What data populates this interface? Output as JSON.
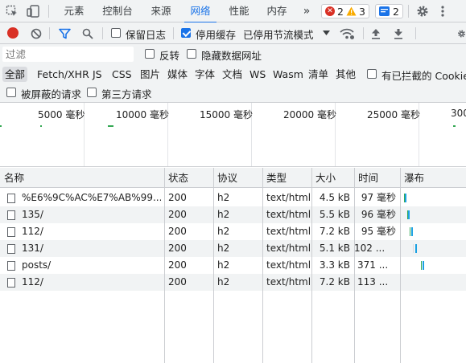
{
  "tabs": [
    "元素",
    "控制台",
    "来源",
    "网络",
    "性能",
    "内存"
  ],
  "active_tab": "网络",
  "more_tabs": "»",
  "badges": {
    "errors": "2",
    "warnings": "3",
    "messages": "2"
  },
  "icons": {
    "inspect": "inspect-element-icon",
    "device": "device-toolbar-icon",
    "record": "record-icon",
    "clear": "clear-icon",
    "filter": "filter-icon",
    "search": "search-icon",
    "wifi": "network-conditions-icon",
    "upload": "import-har-icon",
    "download": "export-har-icon",
    "gear": "gear-icon",
    "kebab": "more-options-icon"
  },
  "toolbar": {
    "preserve_log": "保留日志",
    "disable_cache": "停用缓存",
    "throttle": "已停用节流模式"
  },
  "filter": {
    "placeholder": "过滤",
    "invert": "反转",
    "hide_data_urls": "隐藏数据网址"
  },
  "types": [
    "全部",
    "Fetch/XHR",
    "JS",
    "CSS",
    "图片",
    "媒体",
    "字体",
    "文档",
    "WS",
    "Wasm",
    "清单",
    "其他"
  ],
  "selected_type": "全部",
  "blocked_cookies": "有已拦截的 Cookie",
  "blocked_requests": "被屏蔽的请求",
  "third_party": "第三方请求",
  "timeline": [
    "5000 毫秒",
    "10000 毫秒",
    "15000 毫秒",
    "20000 毫秒",
    "25000 毫秒",
    "300"
  ],
  "columns": [
    "名称",
    "状态",
    "协议",
    "类型",
    "大小",
    "时间",
    "瀑布"
  ],
  "requests": [
    {
      "name": "%E6%9C%AC%E7%AB%99...",
      "status": "200",
      "protocol": "h2",
      "type": "text/html",
      "size": "4.5 kB",
      "time": "97 毫秒"
    },
    {
      "name": "135/",
      "status": "200",
      "protocol": "h2",
      "type": "text/html",
      "size": "5.5 kB",
      "time": "96 毫秒"
    },
    {
      "name": "112/",
      "status": "200",
      "protocol": "h2",
      "type": "text/html",
      "size": "7.2 kB",
      "time": "95 毫秒"
    },
    {
      "name": "131/",
      "status": "200",
      "protocol": "h2",
      "type": "text/html",
      "size": "5.1 kB",
      "time": "102 ..."
    },
    {
      "name": "posts/",
      "status": "200",
      "protocol": "h2",
      "type": "text/html",
      "size": "3.3 kB",
      "time": "371 ..."
    },
    {
      "name": "112/",
      "status": "200",
      "protocol": "h2",
      "type": "text/html",
      "size": "7.2 kB",
      "time": "113 ..."
    }
  ],
  "colors": {
    "accent": "#1a73e8",
    "record": "#d93025",
    "waterfall": "#1ba1e2",
    "error": "#d93025",
    "warning": "#f9ab00"
  }
}
